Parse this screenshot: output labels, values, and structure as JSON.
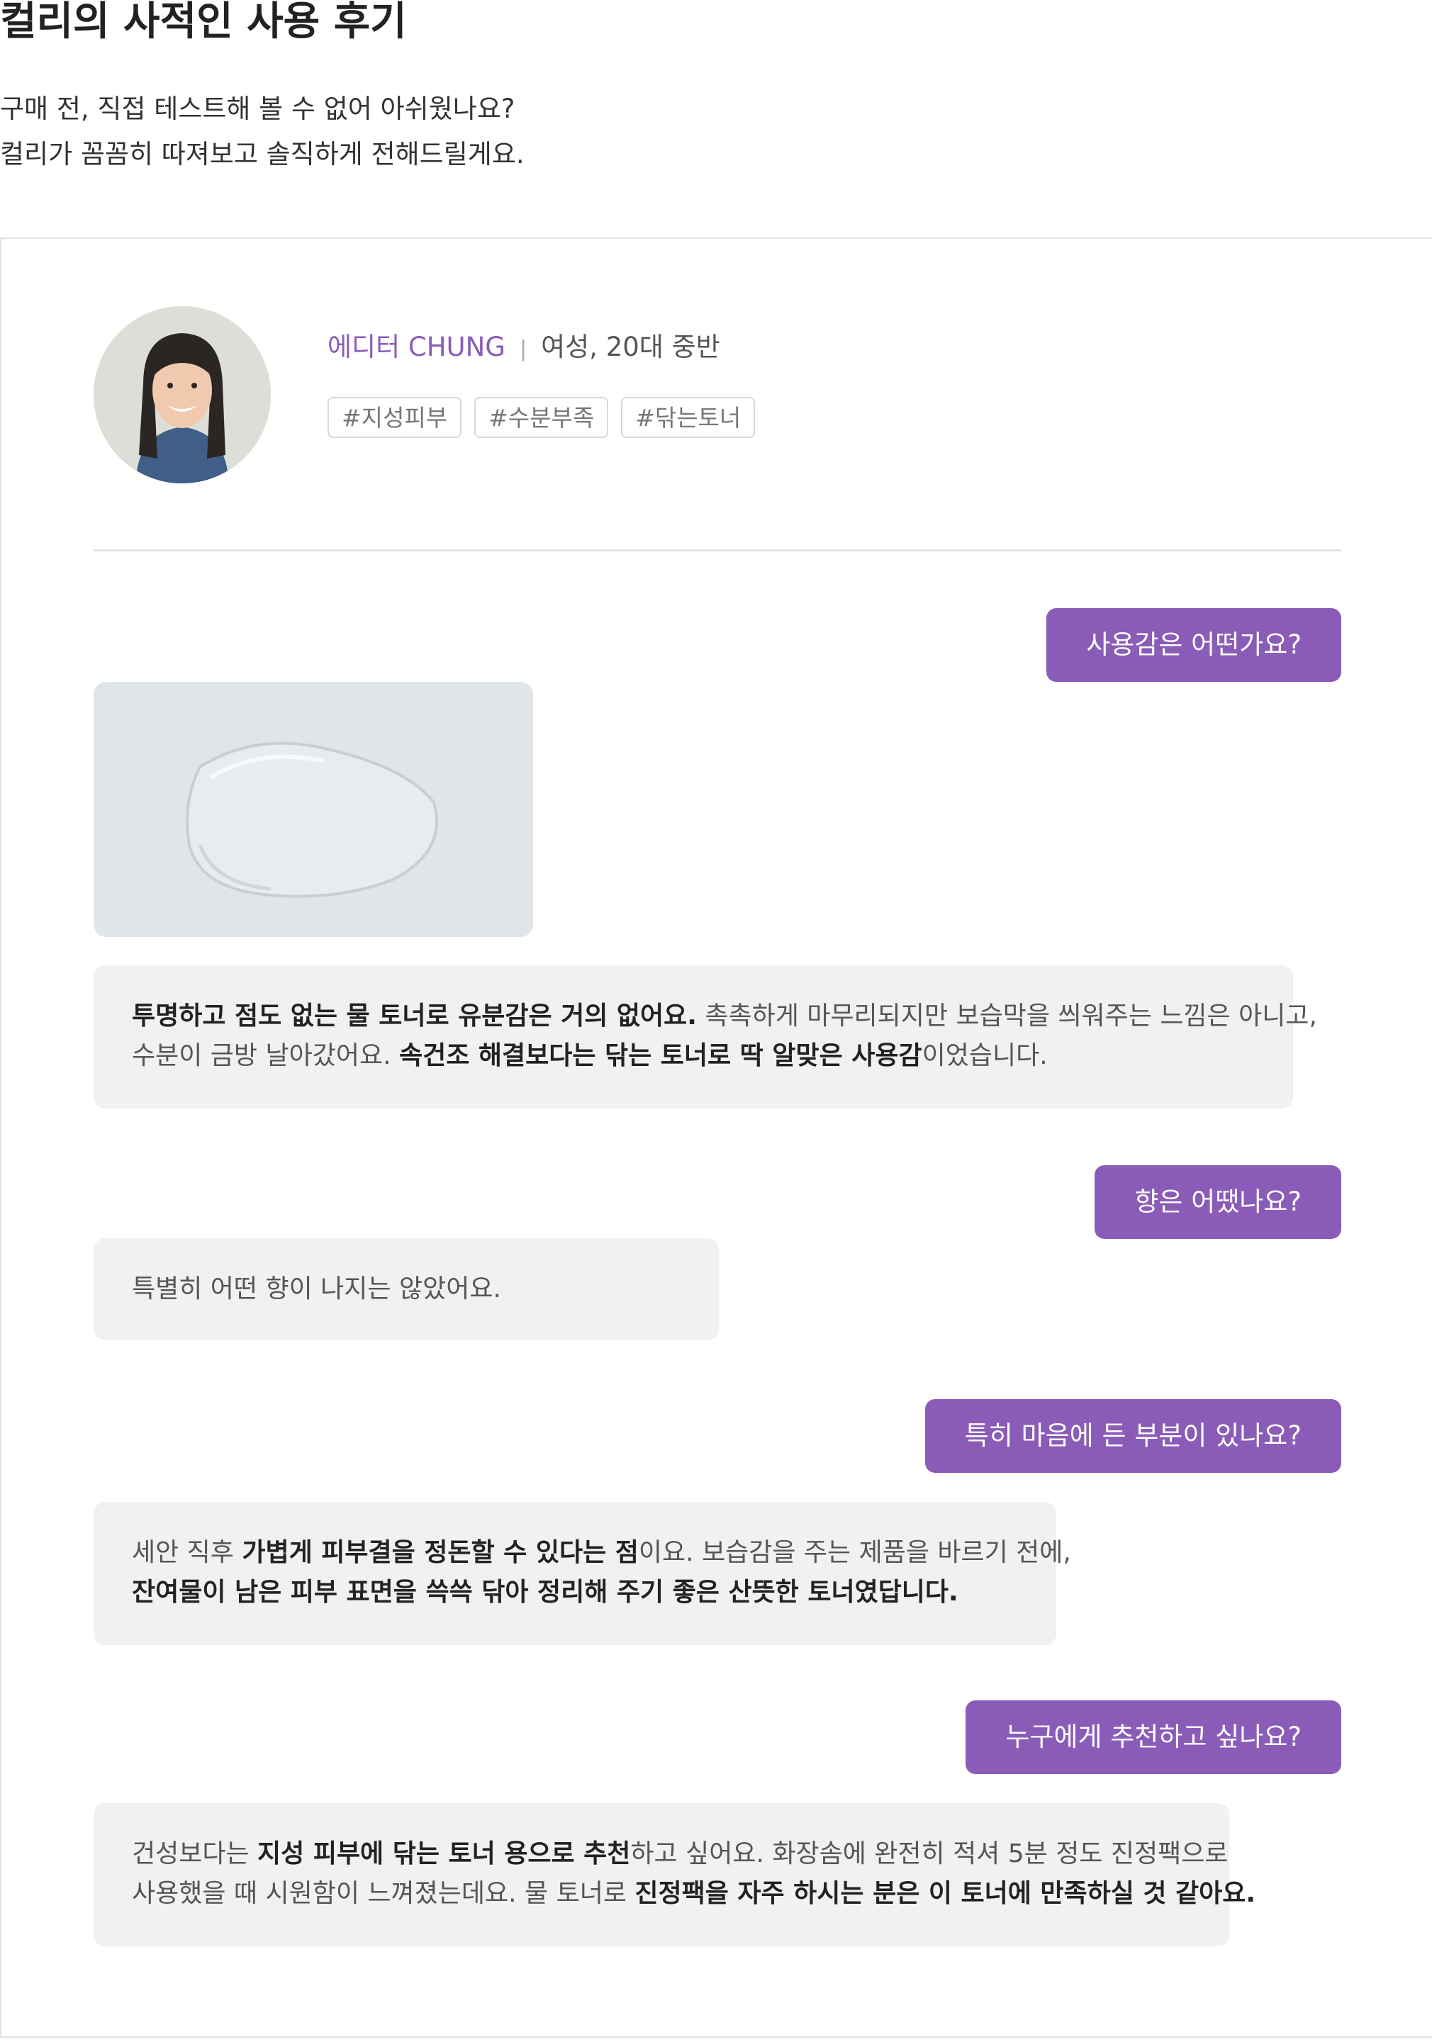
{
  "header": {
    "title": "컬리의 사적인 사용 후기",
    "intro_line1": "구매 전, 직접 테스트해 볼 수 없어 아쉬웠나요?",
    "intro_line2": "컬리가 꼼꼼히 따져보고 솔직하게 전해드릴게요."
  },
  "profile": {
    "editor_name": "에디터 CHUNG",
    "separator": "|",
    "info": "여성, 20대 중반",
    "tags": [
      "#지성피부",
      "#수분부족",
      "#닦는토너"
    ]
  },
  "qa": [
    {
      "question": "사용감은 어떤가요?",
      "answer": {
        "line1_bold": "투명하고 점도 없는 물 토너로 유분감은 거의 없어요.",
        "line1_rest": " 촉촉하게 마무리되지만 보습막을 씌워주는 느낌은 아니고,",
        "line2_start": "수분이 금방 날아갔어요. ",
        "line2_bold": "속건조 해결보다는 닦는 토너로 딱 알맞은 사용감",
        "line2_end": "이었습니다."
      }
    },
    {
      "question": "향은 어땠나요?",
      "answer": {
        "line1": "특별히 어떤 향이 나지는 않았어요."
      }
    },
    {
      "question": "특히 마음에 든 부분이 있나요?",
      "answer": {
        "line1_start": "세안 직후 ",
        "line1_bold": "가볍게 피부결을 정돈할 수 있다는 점",
        "line1_rest": "이요. 보습감을 주는 제품을 바르기 전에,",
        "line2_bold": "잔여물이 남은 피부 표면을 쓱쓱 닦아 정리해 주기 좋은 산뜻한 토너였답니다."
      }
    },
    {
      "question": "누구에게 추천하고 싶나요?",
      "answer": {
        "line1_start": "건성보다는 ",
        "line1_bold": "지성 피부에 닦는 토너 용으로 추천",
        "line1_rest": "하고 싶어요. 화장솜에 완전히 적셔 5분 정도 진정팩으로",
        "line2_start": "사용했을 때 시원함이 느껴졌는데요. 물 토너로 ",
        "line2_bold": "진정팩을 자주 하시는 분은 이 토너에 만족하실 것 같아요."
      }
    }
  ],
  "colors": {
    "accent": "#8a5cb8",
    "bubble_bg": "#f1f1f1",
    "border": "#e3e3e3"
  }
}
